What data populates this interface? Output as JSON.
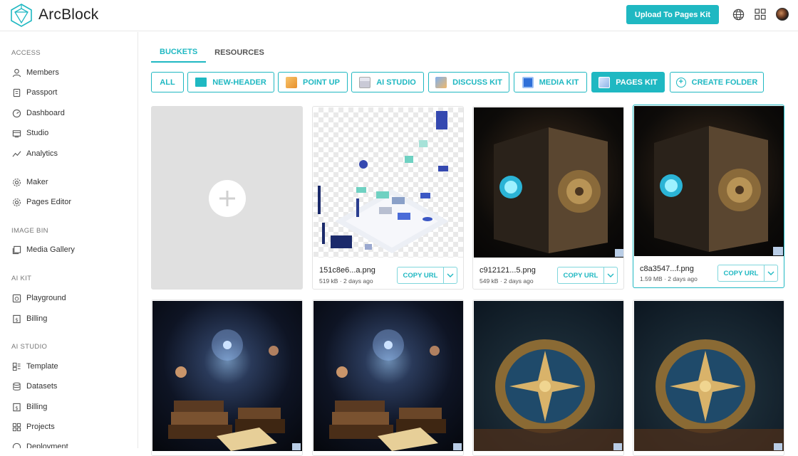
{
  "app": {
    "logo_text": "ArcBlock",
    "upload_button": "Upload To Pages Kit",
    "icons": [
      "globe-icon",
      "apps-grid-icon",
      "user-avatar"
    ]
  },
  "sidebar": {
    "sections": [
      {
        "title": "ACCESS",
        "items": [
          "Members",
          "Passport",
          "Dashboard",
          "Studio",
          "Analytics"
        ]
      },
      {
        "title": "",
        "items": [
          "Maker",
          "Pages Editor"
        ]
      },
      {
        "title": "IMAGE BIN",
        "items": [
          "Media Gallery"
        ]
      },
      {
        "title": "AI KIT",
        "items": [
          "Playground",
          "Billing"
        ]
      },
      {
        "title": "AI STUDIO",
        "items": [
          "Template",
          "Datasets",
          "Billing",
          "Projects",
          "Deployment"
        ]
      }
    ]
  },
  "tabs": [
    {
      "label": "BUCKETS",
      "active": true
    },
    {
      "label": "RESOURCES",
      "active": false
    }
  ],
  "filters": [
    {
      "label": "ALL",
      "active": false
    },
    {
      "label": "NEW-HEADER",
      "active": false
    },
    {
      "label": "POINT UP",
      "active": false
    },
    {
      "label": "AI STUDIO",
      "active": false
    },
    {
      "label": "DISCUSS KIT",
      "active": false
    },
    {
      "label": "MEDIA KIT",
      "active": false
    },
    {
      "label": "PAGES KIT",
      "active": true
    },
    {
      "label": "CREATE FOLDER",
      "active": false
    }
  ],
  "cards": [
    {
      "name": "151c8e6...a.png",
      "size": "519 kB",
      "age": "2 days ago",
      "meta": "519 kB · 2 days ago",
      "copy_label": "COPY URL",
      "image": "isometric-illustration"
    },
    {
      "name": "c912121...5.png",
      "size": "549 kB",
      "age": "2 days ago",
      "meta": "549 kB · 2 days ago",
      "copy_label": "COPY URL",
      "image": "vault-safe"
    },
    {
      "name": "c8a3547...f.png",
      "size": "1.59 MB",
      "age": "2 days ago",
      "meta": "1.59 MB · 2 days ago",
      "copy_label": "COPY URL",
      "image": "vault-safe",
      "selected": true
    }
  ],
  "second_row_images": [
    "space-books",
    "space-books",
    "golden-compass",
    "golden-compass"
  ],
  "colors": {
    "accent": "#1fb8c2",
    "border": "#e8e8e8",
    "text": "#222222"
  }
}
